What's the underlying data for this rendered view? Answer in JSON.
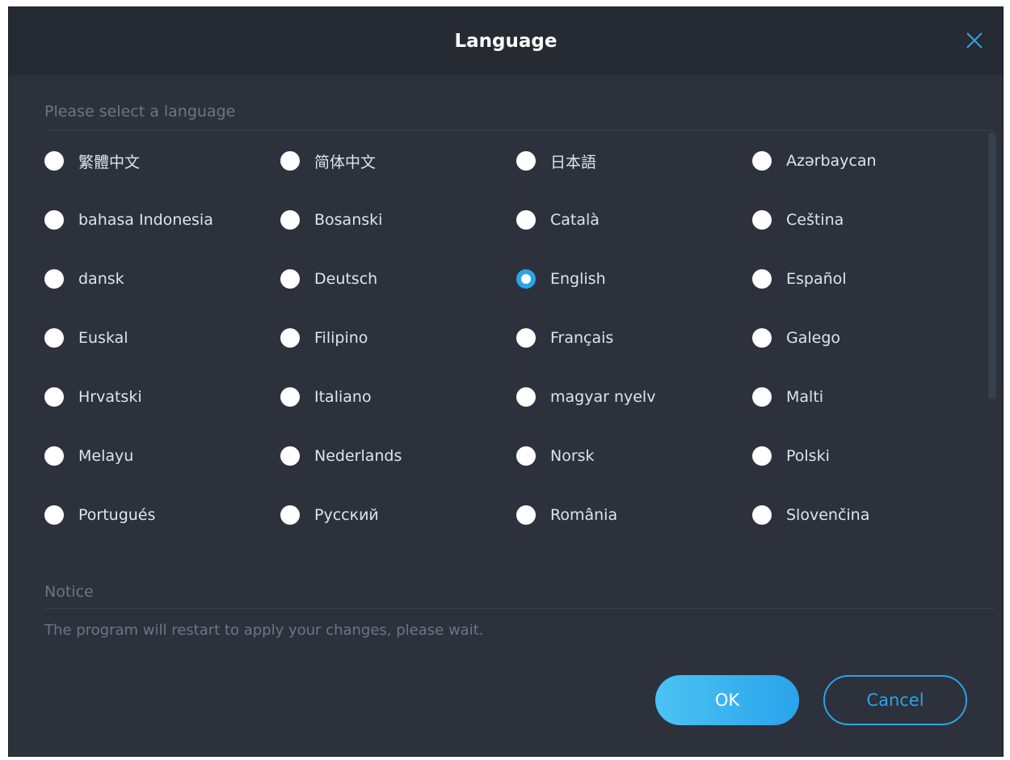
{
  "dialog": {
    "title": "Language",
    "select_prompt": "Please select a language",
    "notice_label": "Notice",
    "notice_text": "The program will restart to apply your changes, please wait.",
    "ok_label": "OK",
    "cancel_label": "Cancel",
    "selected_language": "English",
    "accent_color": "#2aa4e8"
  },
  "languages": [
    "繁體中文",
    "简体中文",
    "日本語",
    "Azərbaycan",
    "bahasa Indonesia",
    "Bosanski",
    "Català",
    "Ceština",
    "dansk",
    "Deutsch",
    "English",
    "Español",
    "Euskal",
    "Filipino",
    "Français",
    "Galego",
    "Hrvatski",
    "Italiano",
    "magyar nyelv",
    "Malti",
    "Melayu",
    "Nederlands",
    "Norsk",
    "Polski",
    "Portugués",
    "Русский",
    "România",
    "Slovenčina"
  ]
}
